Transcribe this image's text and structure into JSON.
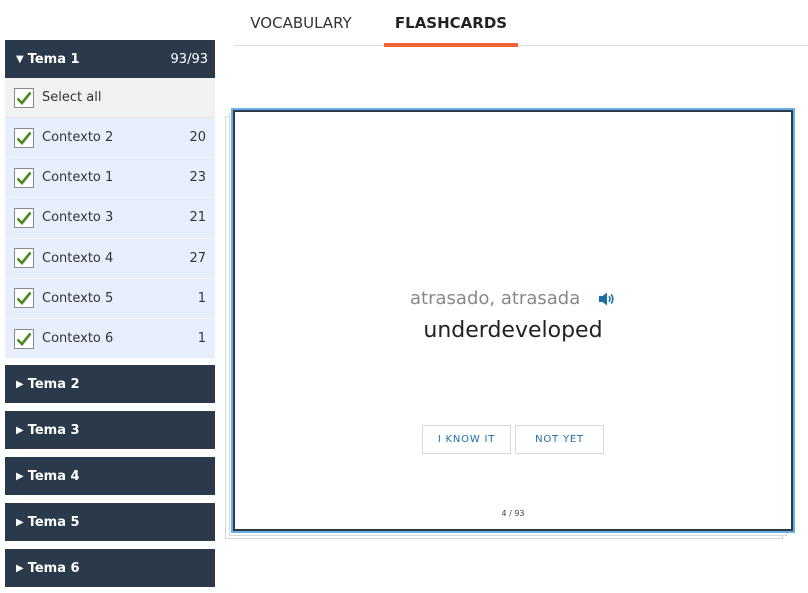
{
  "tabs": [
    {
      "label": "VOCABULARY",
      "active": false
    },
    {
      "label": "FLASHCARDS",
      "active": true
    }
  ],
  "sidebar": {
    "open_group": {
      "label": "Tema 1",
      "count": "93/93",
      "select_all_label": "Select all",
      "contexts": [
        {
          "label": "Contexto 2",
          "count": "20",
          "checked": true
        },
        {
          "label": "Contexto 1",
          "count": "23",
          "checked": true
        },
        {
          "label": "Contexto 3",
          "count": "21",
          "checked": true
        },
        {
          "label": "Contexto 4",
          "count": "27",
          "checked": true
        },
        {
          "label": "Contexto 5",
          "count": "1",
          "checked": true
        },
        {
          "label": "Contexto 6",
          "count": "1",
          "checked": true
        }
      ]
    },
    "collapsed_groups": [
      {
        "label": "Tema 2"
      },
      {
        "label": "Tema 3"
      },
      {
        "label": "Tema 4"
      },
      {
        "label": "Tema 5"
      },
      {
        "label": "Tema 6"
      }
    ]
  },
  "card": {
    "term": "atrasado, atrasada",
    "definition": "underdeveloped",
    "know_label": "I KNOW IT",
    "not_yet_label": "NOT YET",
    "progress": "4 / 93",
    "speaker_icon": "speaker-icon"
  },
  "colors": {
    "sidebar_header": "#2b3a4b",
    "context_row": "#e7efff",
    "tab_underline": "#f0643c",
    "checkmark": "#4a8a1e",
    "button_text": "#1e6fa8",
    "card_focus": "#6aaee6"
  }
}
